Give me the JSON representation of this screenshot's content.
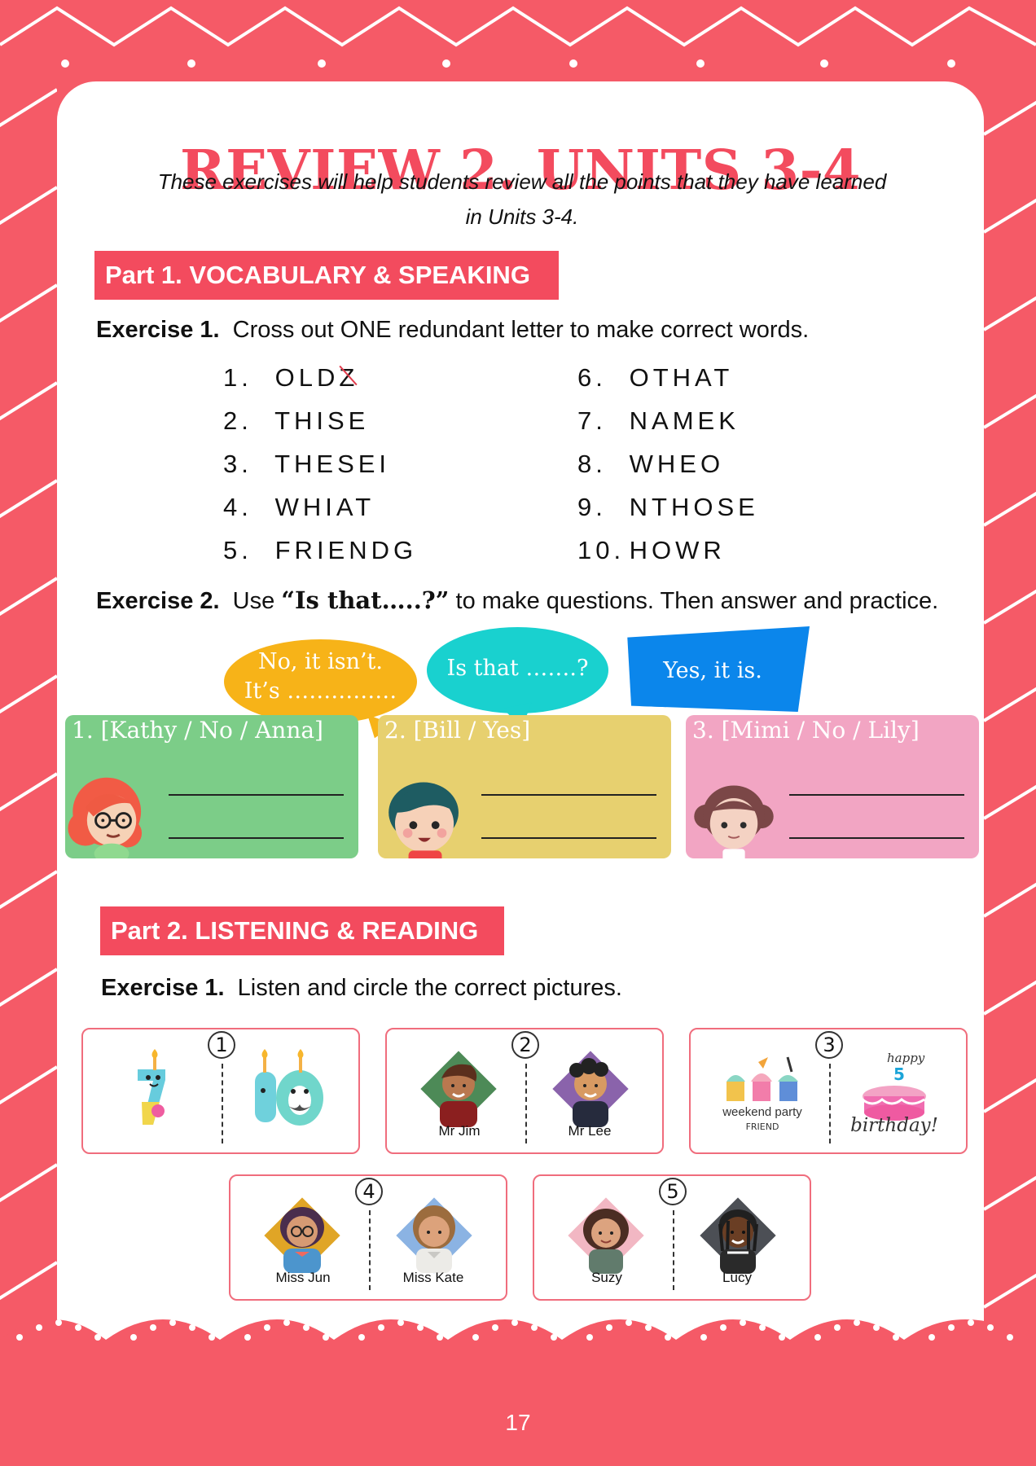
{
  "header": {
    "title": "REVIEW 2. UNITS 3-4",
    "intro_line_1": "These exercises will help students review all the points that they have learned",
    "intro_line_2": "in Units 3-4."
  },
  "part1": {
    "title": "Part 1. VOCABULARY & SPEAKING",
    "exercise1": {
      "label": "Exercise 1.",
      "instruction": "Cross out ONE redundant letter to make correct words.",
      "left_items": [
        {
          "number": "1.",
          "word_before": "OLD",
          "crossed_letter": "Z",
          "word_after": ""
        },
        {
          "number": "2.",
          "word": "THISE"
        },
        {
          "number": "3.",
          "word": "THESEI"
        },
        {
          "number": "4.",
          "word": "WHIAT"
        },
        {
          "number": "5.",
          "word": "FRIENDG"
        }
      ],
      "right_items": [
        {
          "number": "6.",
          "word": "OTHAT"
        },
        {
          "number": "7.",
          "word": "NAMEK"
        },
        {
          "number": "8.",
          "word": "WHEO"
        },
        {
          "number": "9.",
          "word": "NTHOSE"
        },
        {
          "number": "10.",
          "word": "HOWR"
        }
      ]
    },
    "exercise2": {
      "label": "Exercise 2.",
      "instruction_before": "Use",
      "instruction_quote": "“Is that…..?”",
      "instruction_after": "to make questions. Then answer and practice.",
      "bubbles": {
        "orange_line_1": "No, it isn’t.",
        "orange_line_2": "It’s ……………",
        "teal": "Is that …….?",
        "blue": "Yes, it is."
      },
      "cards": [
        {
          "label": "1. [Kathy / No / Anna]"
        },
        {
          "label": "2. [Bill / Yes]"
        },
        {
          "label": "3. [Mimi / No / Lily]"
        }
      ]
    }
  },
  "part2": {
    "title": "Part 2. LISTENING & READING",
    "exercise1": {
      "label": "Exercise 1.",
      "instruction": "Listen and circle the correct pictures.",
      "boxes": [
        {
          "number": "1",
          "left_caption": "",
          "right_caption": ""
        },
        {
          "number": "2",
          "left_caption": "Mr Jim",
          "right_caption": "Mr Lee"
        },
        {
          "number": "3",
          "left_caption": "",
          "right_caption": ""
        },
        {
          "number": "4",
          "left_caption": "Miss Jun",
          "right_caption": "Miss Kate"
        },
        {
          "number": "5",
          "left_caption": "Suzy",
          "right_caption": "Lucy"
        }
      ],
      "picture_text": {
        "party_line_1": "weekend party",
        "party_line_2": "FRIEND",
        "birthday_top": "happy",
        "birthday_number": "5",
        "birthday_bottom": "birthday!"
      }
    }
  },
  "footer": {
    "page_number": "17"
  },
  "colors": {
    "background": "#f55a67",
    "title": "#f34b5e",
    "orange_bubble": "#f7b318",
    "teal_bubble": "#19d1cf",
    "blue_bubble": "#0b86eb",
    "green_card": "#7ccd88",
    "yellow_card": "#e7d06f",
    "pink_card": "#f2a5c3"
  },
  "icons": [
    "number-seven-icon",
    "number-ten-icon",
    "cupcake-icon",
    "birthday-cake-icon",
    "person-avatar-icon"
  ]
}
